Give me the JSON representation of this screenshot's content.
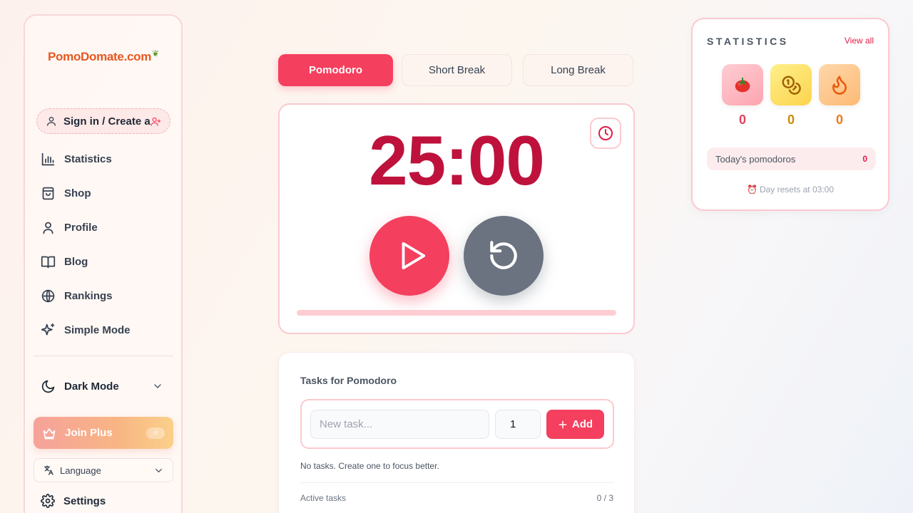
{
  "sidebar": {
    "logo_text": "PomoDomate.com",
    "signin_label": "Sign in / Create account",
    "nav": [
      {
        "label": "Statistics",
        "icon": "bar-chart-icon"
      },
      {
        "label": "Shop",
        "icon": "shopping-bag-icon"
      },
      {
        "label": "Profile",
        "icon": "user-icon"
      },
      {
        "label": "Blog",
        "icon": "book-icon"
      },
      {
        "label": "Rankings",
        "icon": "globe-icon"
      },
      {
        "label": "Simple Mode",
        "icon": "sparkles-icon"
      }
    ],
    "dark_mode_label": "Dark Mode",
    "join_plus_label": "Join Plus",
    "language_label": "Language",
    "settings_label": "Settings"
  },
  "tabs": [
    {
      "label": "Pomodoro",
      "active": true
    },
    {
      "label": "Short Break",
      "active": false
    },
    {
      "label": "Long Break",
      "active": false
    }
  ],
  "timer": {
    "display": "25:00",
    "progress": 0
  },
  "tasks": {
    "title": "Tasks for Pomodoro",
    "input_placeholder": "New task...",
    "quantity_value": "1",
    "add_label": "Add",
    "empty_text": "No tasks. Create one to focus better.",
    "active_label": "Active tasks",
    "active_count": "0 / 3"
  },
  "stats": {
    "title": "STATISTICS",
    "view_all": "View all",
    "items": [
      {
        "icon": "tomato-icon",
        "value": "0"
      },
      {
        "icon": "coins-icon",
        "value": "0"
      },
      {
        "icon": "flame-icon",
        "value": "0"
      }
    ],
    "today_label": "Today's pomodoros",
    "today_value": "0",
    "reset_text": "Day resets at 03:00"
  },
  "colors": {
    "accent": "#f43f5e",
    "timer_text": "#be123c",
    "reset_button": "#6b7280"
  }
}
